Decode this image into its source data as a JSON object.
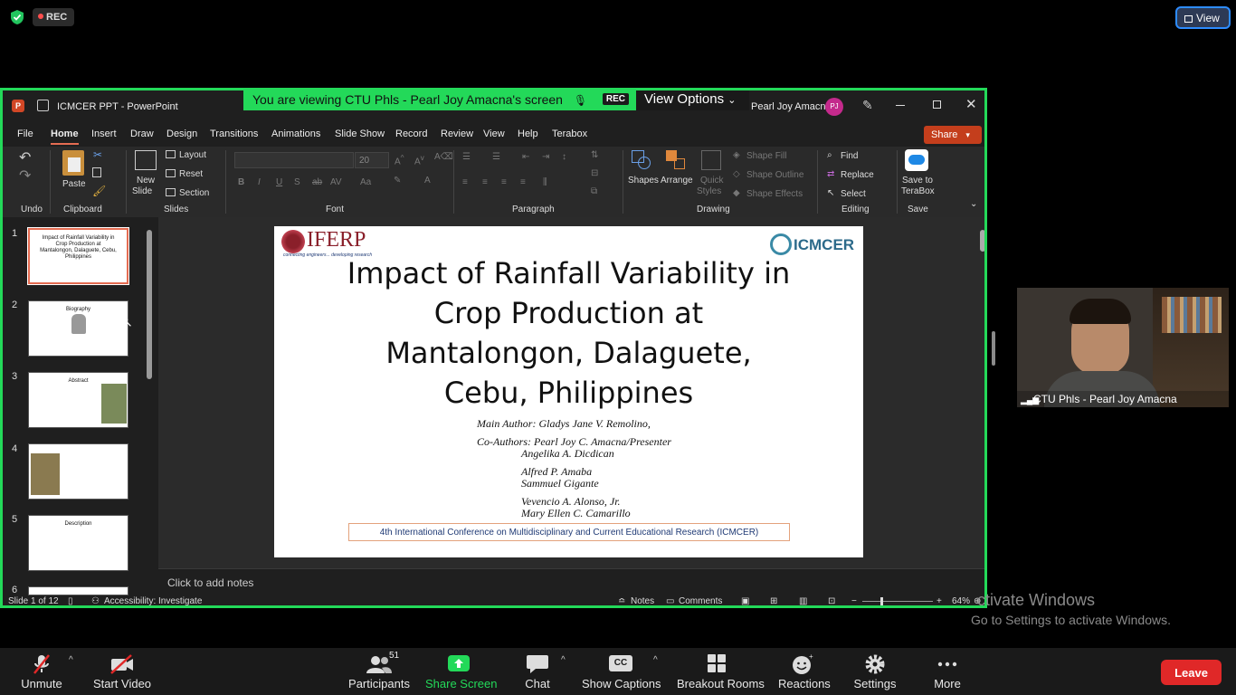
{
  "overlay": {
    "rec_label": "REC",
    "view_label": "View"
  },
  "banner": {
    "text": "You are viewing CTU Phls - Pearl Joy Amacna's screen",
    "rec": "REC",
    "view_options": "View Options"
  },
  "ppt": {
    "window_title": "ICMCER PPT - PowerPoint",
    "user_name": "Pearl Joy Amacna",
    "user_initials": "PJ",
    "share_label": "Share",
    "tabs": [
      "File",
      "Home",
      "Insert",
      "Draw",
      "Design",
      "Transitions",
      "Animations",
      "Slide Show",
      "Record",
      "Review",
      "View",
      "Help",
      "Terabox"
    ],
    "ribbon": {
      "undo_group": "Undo",
      "paste": "Paste",
      "clipboard_group": "Clipboard",
      "new_slide_1": "New",
      "new_slide_2": "Slide",
      "layout": "Layout",
      "reset": "Reset",
      "section": "Section",
      "slides_group": "Slides",
      "font_size": "20",
      "font_group": "Font",
      "paragraph_group": "Paragraph",
      "shapes": "Shapes",
      "arrange": "Arrange",
      "quick_styles_1": "Quick",
      "quick_styles_2": "Styles",
      "shape_fill": "Shape Fill",
      "shape_outline": "Shape Outline",
      "shape_effects": "Shape Effects",
      "drawing_group": "Drawing",
      "find": "Find",
      "replace": "Replace",
      "select": "Select",
      "editing_group": "Editing",
      "save_terabox_1": "Save to",
      "save_terabox_2": "TeraBox",
      "save_group": "Save"
    },
    "thumbnails": [
      {
        "num": "1",
        "title": "Impact of Rainfall Variability in Crop Production at Mantalongon, Dalaguete, Cebu, Philippines"
      },
      {
        "num": "2",
        "title": "Biography"
      },
      {
        "num": "3",
        "title": "Abstract"
      },
      {
        "num": "4",
        "title": ""
      },
      {
        "num": "5",
        "title": "Description"
      },
      {
        "num": "6",
        "title": ""
      }
    ],
    "slide": {
      "iferp_logo": "IFERP",
      "iferp_tagline": "connecting engineers... developing research",
      "icmcer_logo": "ICMCER",
      "title_lines": [
        "Impact of Rainfall Variability in",
        "Crop Production at",
        "Mantalongon, Dalaguete,",
        "Cebu, Philippines"
      ],
      "main_author": "Main Author: Gladys Jane V. Remolino,",
      "co_authors_label": "Co-Authors: Pearl Joy C. Amacna/Presenter",
      "co_authors": [
        "Angelika A. Dicdican",
        "Alfred P. Amaba",
        "Sammuel Gigante",
        "Vevencio A. Alonso, Jr.",
        "Mary Ellen C. Camarillo"
      ],
      "conference": "4th International Conference on Multidisciplinary and Current Educational Research (ICMCER)"
    },
    "notes_placeholder": "Click to add notes",
    "status": {
      "slide_count": "Slide 1 of 12",
      "accessibility": "Accessibility: Investigate",
      "notes": "Notes",
      "comments": "Comments",
      "zoom": "64%"
    }
  },
  "video": {
    "participant": "CTU Phls - Pearl Joy Amacna"
  },
  "windows_watermark": {
    "line1": "ctivate Windows",
    "line2": "Go to Settings to activate Windows."
  },
  "toolbar": {
    "unmute": "Unmute",
    "start_video": "Start Video",
    "participants": "Participants",
    "participant_count": "51",
    "share_screen": "Share Screen",
    "chat": "Chat",
    "show_captions": "Show Captions",
    "captions_icon": "CC",
    "breakout_rooms": "Breakout Rooms",
    "reactions": "Reactions",
    "settings": "Settings",
    "more": "More",
    "leave": "Leave"
  },
  "colors": {
    "share_border": "#23d959",
    "accent": "#c43e1c",
    "leave": "#e02828",
    "zoom_blue": "#2d8cff"
  }
}
